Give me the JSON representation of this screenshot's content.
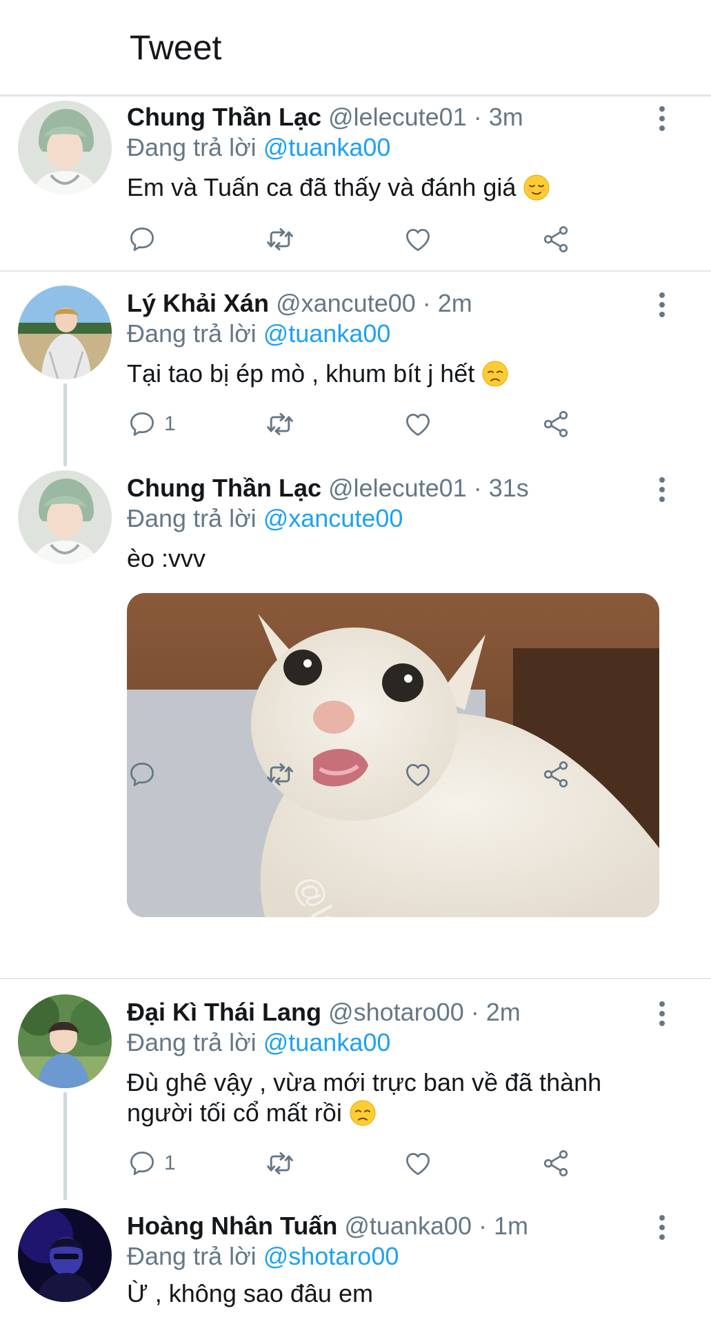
{
  "header": {
    "title": "Tweet"
  },
  "reply_prefix": "Đang trả lời",
  "tweets": [
    {
      "name": "Chung Thần Lạc",
      "handle": "@lelecute01",
      "time": "· 3m",
      "reply_to": "@tuanka00",
      "text": "Em và Tuấn ca đã thấy và đánh giá",
      "emoji": "relieved-face",
      "reply_count": "",
      "avatar": "green-hair-portrait"
    },
    {
      "name": "Lý Khải Xán",
      "handle": "@xancute00",
      "time": "· 2m",
      "reply_to": "@tuanka00",
      "text": "Tại tao bị ép mò , khum bít j hết",
      "emoji": "disappointed-face",
      "reply_count": "1",
      "avatar": "outdoor-portrait"
    },
    {
      "name": "Chung Thần Lạc",
      "handle": "@lelecute01",
      "time": "· 31s",
      "reply_to": "@xancute00",
      "text": "èo :vvv",
      "emoji": "",
      "reply_count": "",
      "avatar": "green-hair-portrait",
      "media": {
        "subject": "white-cat-meme-photo",
        "watermark": "@Idas"
      }
    },
    {
      "name": "Đại Kì Thái Lang",
      "handle": "@shotaro00",
      "time": "· 2m",
      "reply_to": "@tuanka00",
      "text": "Đù ghê vậy , vừa mới trực ban về đã thành người tối cổ mất rồi",
      "emoji": "disappointed-face",
      "reply_count": "1",
      "avatar": "garden-portrait"
    },
    {
      "name": "Hoàng Nhân Tuấn",
      "handle": "@tuanka00",
      "time": "· 1m",
      "reply_to": "@shotaro00",
      "text": "Ừ , không sao đâu em",
      "emoji": "",
      "reply_count": "",
      "avatar": "dark-blue-portrait"
    }
  ],
  "colors": {
    "accent": "#1da1f2",
    "secondary_text": "#657786",
    "divider": "#e1e6ea"
  }
}
